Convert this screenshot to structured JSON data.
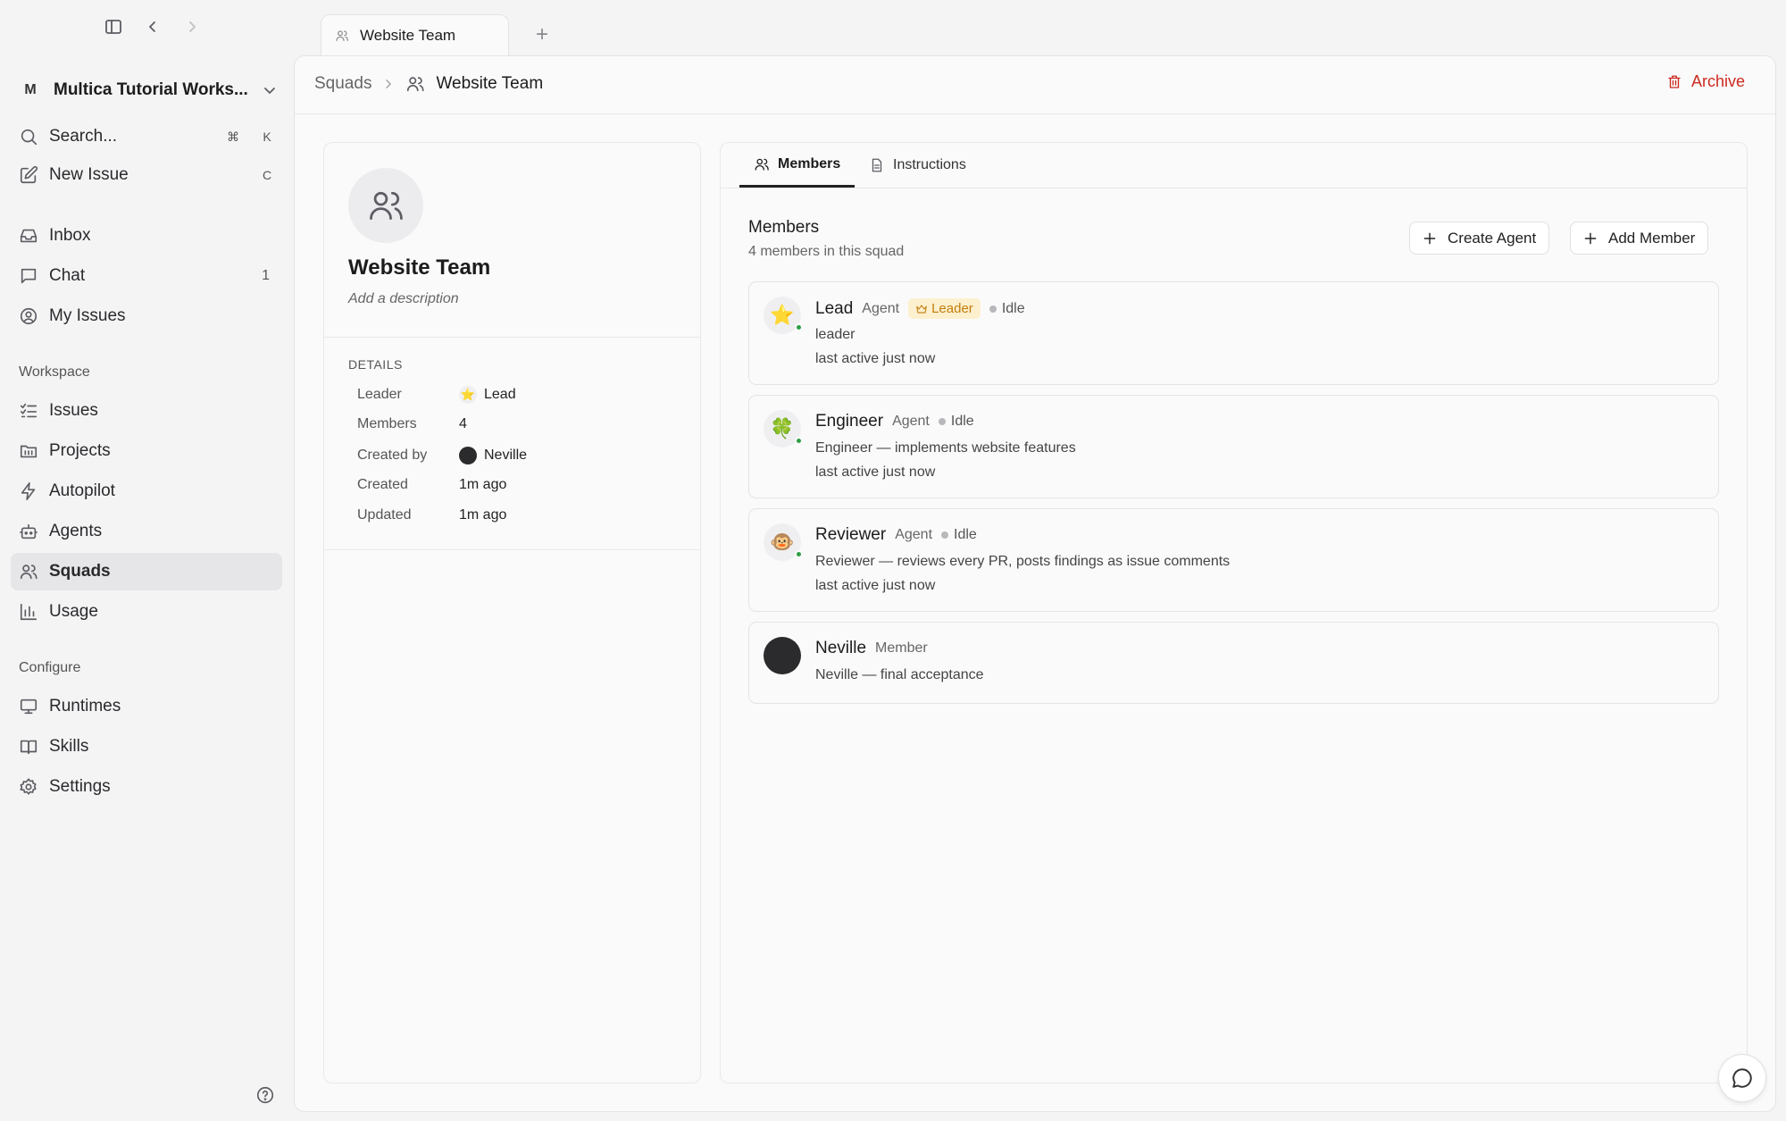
{
  "tab": {
    "title": "Website Team",
    "add": "+"
  },
  "sidebar": {
    "workspace": {
      "initial": "M",
      "name": "Multica Tutorial Works..."
    },
    "search": {
      "label": "Search...",
      "k1": "⌘",
      "k2": "K"
    },
    "new_issue": {
      "label": "New Issue",
      "key": "C"
    },
    "items": [
      {
        "label": "Inbox"
      },
      {
        "label": "Chat",
        "count": "1"
      },
      {
        "label": "My Issues"
      }
    ],
    "workspace_title": "Workspace",
    "workspace_items": [
      {
        "label": "Issues"
      },
      {
        "label": "Projects"
      },
      {
        "label": "Autopilot"
      },
      {
        "label": "Agents"
      },
      {
        "label": "Squads"
      },
      {
        "label": "Usage"
      }
    ],
    "configure_title": "Configure",
    "configure_items": [
      {
        "label": "Runtimes"
      },
      {
        "label": "Skills"
      },
      {
        "label": "Settings"
      }
    ]
  },
  "header": {
    "crumb_parent": "Squads",
    "crumb_current": "Website Team",
    "archive": "Archive"
  },
  "squad": {
    "name": "Website Team",
    "description_placeholder": "Add a description",
    "details_title": "DETAILS",
    "details": [
      {
        "key": "Leader",
        "value": "Lead"
      },
      {
        "key": "Members",
        "value": "4"
      },
      {
        "key": "Created by",
        "value": "Neville"
      },
      {
        "key": "Created",
        "value": "1m ago"
      },
      {
        "key": "Updated",
        "value": "1m ago"
      }
    ]
  },
  "tabs": {
    "members": "Members",
    "instructions": "Instructions"
  },
  "members": {
    "title": "Members",
    "subtitle": "4 members in this squad",
    "create_agent": "Create Agent",
    "add_member": "Add Member",
    "list": [
      {
        "name": "Lead",
        "type": "Agent",
        "badge": "Leader",
        "status": "Idle",
        "desc": "leader",
        "active": "last active just now",
        "emoji": "⭐"
      },
      {
        "name": "Engineer",
        "type": "Agent",
        "status": "Idle",
        "desc": "Engineer — implements website features",
        "active": "last active just now",
        "emoji": "🍀"
      },
      {
        "name": "Reviewer",
        "type": "Agent",
        "status": "Idle",
        "desc": "Reviewer — reviews every PR, posts findings as issue comments",
        "active": "last active just now",
        "emoji": "🐵"
      },
      {
        "name": "Neville",
        "type": "Member",
        "desc": "Neville — final acceptance"
      }
    ]
  }
}
